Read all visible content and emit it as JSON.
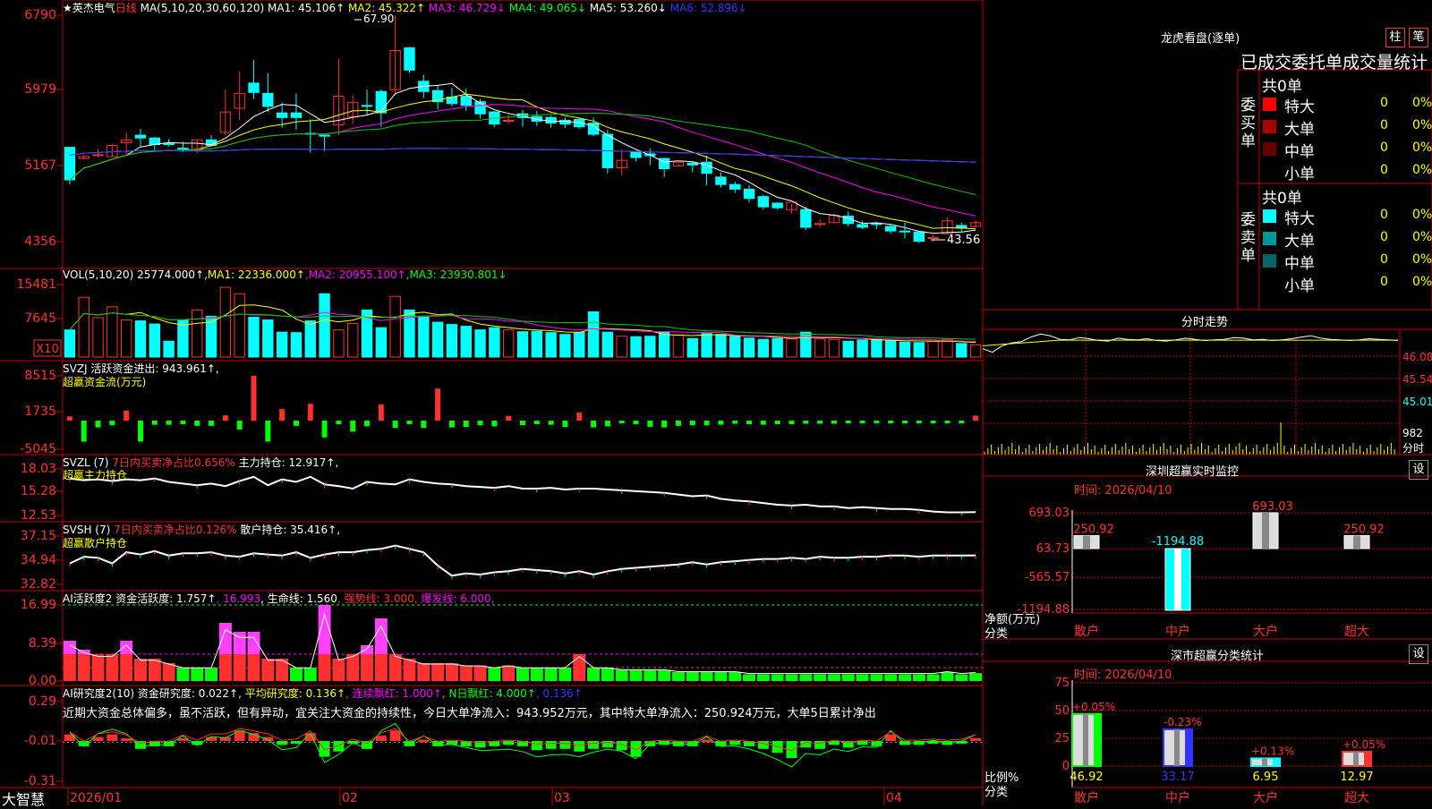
{
  "app": {
    "brand": "大智慧"
  },
  "stock": {
    "name": "英杰电气",
    "period": "日线"
  },
  "panels": {
    "price": {
      "header": [
        {
          "t": "★英杰电气",
          "c": "#ffffff"
        },
        {
          "t": "日线",
          "c": "#ff3030"
        },
        {
          "t": " MA(5,10,20,30,60,120) MA1: ",
          "c": "#ffffff"
        },
        {
          "t": "45.106↑",
          "c": "#ffffff"
        },
        {
          "t": " MA2: 45.322↑",
          "c": "#ffff00"
        },
        {
          "t": " MA3: 46.729↓",
          "c": "#ff00ff"
        },
        {
          "t": " MA4: 49.065↓",
          "c": "#00ff00"
        },
        {
          "t": " MA5: 53.260↓",
          "c": "#ffffff"
        },
        {
          "t": " MA6: 52.896↓",
          "c": "#3333ff"
        }
      ],
      "yticks": [
        "6790",
        "5979",
        "5167",
        "4356"
      ],
      "high_label": "67.90",
      "low_label": "43.56"
    },
    "vol": {
      "header": [
        {
          "t": "VOL(5,10,20) ",
          "c": "#ffffff"
        },
        {
          "t": "25774.000↑",
          "c": "#ffffff"
        },
        {
          "t": ",MA1: 22336.000↑",
          "c": "#ffff00"
        },
        {
          "t": ",MA2: 20955.100↑",
          "c": "#ff00ff"
        },
        {
          "t": ",MA3: 23930.801↓",
          "c": "#00ff00"
        }
      ],
      "yticks": [
        "15481",
        "7645"
      ],
      "unit_badge": "X10"
    },
    "svzj": {
      "header": [
        {
          "t": "SVZJ  活跃资金进出: 943.961↑,",
          "c": "#ffffff"
        }
      ],
      "sub": "超赢资金流(万元)",
      "yticks": [
        "8515",
        "1735",
        "-5045"
      ]
    },
    "svzl": {
      "header": [
        {
          "t": "SVZL (7) ",
          "c": "#ffffff"
        },
        {
          "t": "7日内买卖净占比0.656%",
          "c": "#ff3030"
        },
        {
          "t": " 主力持仓: 12.917↑,",
          "c": "#ffffff"
        }
      ],
      "sub": "超赢主力持仓",
      "yticks": [
        "18.03",
        "15.28",
        "12.53"
      ]
    },
    "svsh": {
      "header": [
        {
          "t": "SVSH (7) ",
          "c": "#ffffff"
        },
        {
          "t": "7日内买卖净占比0.126%",
          "c": "#ff3030"
        },
        {
          "t": " 散户持仓: 35.416↑,",
          "c": "#ffffff"
        }
      ],
      "sub": "超赢散户持仓",
      "yticks": [
        "37.15",
        "34.94",
        "32.82"
      ]
    },
    "ai1": {
      "header": [
        {
          "t": "AI活跃度2 资金活跃度: 1.757↑",
          "c": "#ffffff"
        },
        {
          "t": ", 16.993",
          "c": "#ff00ff"
        },
        {
          "t": ", 生命线: 1.560",
          "c": "#ffffff"
        },
        {
          "t": ", 强势线: 3.000",
          "c": "#ff3030"
        },
        {
          "t": ", 爆发线: 6.000,",
          "c": "#ff00ff"
        }
      ],
      "yticks": [
        "16.99",
        "8.39",
        "0.00"
      ]
    },
    "ai2": {
      "header": [
        {
          "t": "AI研究度2(10) 资金研究度: 0.022↑",
          "c": "#ffffff"
        },
        {
          "t": ", 平均研究度: 0.136↑",
          "c": "#ffff00"
        },
        {
          "t": ", 连续飘红: 1.000↑",
          "c": "#ff00ff"
        },
        {
          "t": ", N日飘红: 4.000↑",
          "c": "#00ff00"
        },
        {
          "t": ", 0.136↑",
          "c": "#3333ff"
        }
      ],
      "comment": "近期大资金总体偏多，虽不活跃，但有异动，宜关注大资金的持续性，今日大单净流入：943.952万元，其中特大单净流入：250.924万元，大单5日累计净出",
      "yticks": [
        "0.29",
        "-0.01",
        "-0.31"
      ]
    }
  },
  "xaxis": {
    "labels": [
      "2026/01",
      "02",
      "03",
      "04"
    ]
  },
  "right": {
    "lhkp": {
      "title": "龙虎看盘(逐单)",
      "tabs": [
        "柱",
        "笔"
      ],
      "subtitle": "已成交委托单成交量统计",
      "buy": {
        "label": "委买单",
        "total": "共0单",
        "rows": [
          {
            "name": "特大",
            "count": "0",
            "pct": "0%",
            "color": "#ff0000"
          },
          {
            "name": "大单",
            "count": "0",
            "pct": "0%",
            "color": "#aa0000"
          },
          {
            "name": "中单",
            "count": "0",
            "pct": "0%",
            "color": "#660000"
          },
          {
            "name": "小单",
            "count": "0",
            "pct": "0%",
            "color": ""
          }
        ]
      },
      "sell": {
        "label": "委卖单",
        "total": "共0单",
        "rows": [
          {
            "name": "特大",
            "count": "0",
            "pct": "0%",
            "color": "#00ffff"
          },
          {
            "name": "大单",
            "count": "0",
            "pct": "0%",
            "color": "#009999"
          },
          {
            "name": "中单",
            "count": "0",
            "pct": "0%",
            "color": "#006666"
          },
          {
            "name": "小单",
            "count": "0",
            "pct": "0%",
            "color": ""
          }
        ]
      }
    },
    "fszs": {
      "title": "分时走势",
      "yticks": [
        "46.08",
        "45.54",
        "45.01",
        "982",
        "分时"
      ]
    },
    "szcy": {
      "title": "深圳超赢实时监控",
      "set": "设",
      "time": "时间: 2026/04/10",
      "yticks": [
        "693.03",
        "63.73",
        "-565.57",
        "-1194.88"
      ],
      "ylabel1": "净额(万元)",
      "ylabel2": "分类"
    },
    "sscy": {
      "title": "深市超赢分类统计",
      "set": "设",
      "time": "时间: 2026/04/10",
      "yticks": [
        "75",
        "50",
        "25",
        "0"
      ],
      "ylabel1": "比例%",
      "ylabel2": "分类"
    }
  },
  "chart_data": [
    {
      "type": "candlestick",
      "title": "英杰电气 日线",
      "ylim": [
        43.56,
        67.9
      ],
      "ohlc": [
        [
          53.7,
          53.7,
          50.2,
          49.7
        ],
        [
          52.5,
          52.9,
          52.7,
          52.4
        ],
        [
          52.9,
          53.5,
          52.9,
          52.6
        ],
        [
          52.7,
          54.1,
          53.9,
          52.7
        ],
        [
          54.2,
          55.3,
          54.5,
          53.0
        ],
        [
          55.0,
          55.7,
          54.7,
          53.8
        ],
        [
          54.7,
          54.8,
          54.0,
          53.4
        ],
        [
          54.1,
          54.6,
          54.0,
          53.8
        ],
        [
          53.6,
          54.3,
          53.5,
          53.2
        ],
        [
          53.4,
          54.5,
          54.5,
          53.1
        ],
        [
          54.5,
          55.0,
          53.9,
          53.8
        ],
        [
          55.3,
          59.9,
          57.5,
          55.0
        ],
        [
          57.9,
          61.9,
          59.5,
          56.6
        ],
        [
          60.6,
          63.1,
          59.6,
          58.9
        ],
        [
          59.5,
          61.7,
          58.1,
          57.5
        ],
        [
          57.4,
          58.5,
          56.9,
          55.8
        ],
        [
          57.4,
          59.5,
          56.9,
          55.6
        ],
        [
          55.2,
          56.7,
          55.1,
          53.1
        ],
        [
          55.0,
          55.0,
          54.9,
          53.3
        ],
        [
          56.1,
          63.2,
          59.2,
          55.0
        ],
        [
          57.0,
          59.3,
          58.5,
          56.2
        ],
        [
          58.2,
          59.9,
          58.1,
          57.1
        ],
        [
          59.7,
          59.9,
          57.4,
          55.9
        ],
        [
          59.9,
          67.9,
          64.1,
          59.5
        ],
        [
          64.4,
          64.5,
          62.0,
          61.7
        ],
        [
          60.8,
          61.5,
          59.7,
          59.0
        ],
        [
          59.8,
          60.4,
          58.6,
          57.8
        ],
        [
          59.1,
          60.1,
          58.4,
          58.1
        ],
        [
          59.2,
          60.0,
          58.2,
          57.6
        ],
        [
          58.6,
          58.9,
          57.3,
          56.8
        ],
        [
          57.5,
          57.6,
          56.2,
          55.9
        ],
        [
          56.6,
          57.2,
          56.6,
          56.2
        ],
        [
          57.3,
          57.7,
          56.9,
          55.9
        ],
        [
          57.0,
          57.6,
          56.5,
          56.0
        ],
        [
          56.9,
          57.1,
          56.3,
          55.8
        ],
        [
          56.6,
          56.9,
          56.2,
          55.8
        ],
        [
          56.7,
          56.8,
          55.9,
          55.7
        ],
        [
          56.3,
          56.9,
          55.1,
          54.9
        ],
        [
          55.1,
          55.6,
          51.5,
          50.9
        ],
        [
          51.5,
          53.5,
          52.3,
          50.7
        ],
        [
          53.2,
          53.3,
          52.6,
          52.2
        ],
        [
          53.0,
          53.6,
          52.8,
          51.8
        ],
        [
          52.5,
          52.5,
          51.4,
          50.5
        ],
        [
          51.7,
          51.9,
          52.1,
          51.6
        ],
        [
          52.0,
          52.2,
          51.8,
          51.0
        ],
        [
          52.1,
          52.8,
          50.9,
          49.6
        ],
        [
          50.5,
          51.0,
          49.7,
          49.4
        ],
        [
          49.7,
          50.0,
          49.2,
          48.8
        ],
        [
          49.2,
          49.6,
          48.2,
          47.8
        ],
        [
          48.4,
          48.6,
          47.3,
          47.0
        ],
        [
          47.7,
          47.8,
          47.2,
          47.0
        ],
        [
          47.0,
          47.6,
          47.8,
          46.6
        ],
        [
          47.0,
          47.3,
          45.1,
          44.8
        ],
        [
          45.4,
          46.0,
          45.5,
          45.1
        ],
        [
          45.6,
          46.6,
          46.4,
          45.6
        ],
        [
          46.3,
          46.8,
          45.5,
          45.2
        ],
        [
          45.4,
          45.8,
          45.1,
          44.9
        ],
        [
          45.5,
          45.7,
          45.4,
          44.9
        ],
        [
          45.2,
          45.4,
          44.7,
          44.4
        ],
        [
          44.7,
          45.6,
          44.6,
          43.9
        ],
        [
          44.6,
          44.7,
          43.6,
          43.4
        ],
        [
          43.9,
          44.3,
          44.0,
          43.56
        ],
        [
          44.4,
          46.2,
          45.8,
          44.4
        ],
        [
          45.3,
          45.6,
          45.0,
          44.6
        ],
        [
          45.2,
          45.9,
          45.6,
          45.1
        ]
      ]
    },
    {
      "type": "bar",
      "title": "VOL(5,10,20)",
      "ylim": [
        0,
        17000
      ],
      "values": [
        6000,
        13200,
        8700,
        11100,
        8200,
        8000,
        7300,
        3500,
        8200,
        10400,
        9000,
        15400,
        14000,
        8800,
        8200,
        5500,
        5400,
        8000,
        14000,
        6000,
        7400,
        10400,
        6500,
        13400,
        10400,
        8800,
        7700,
        7200,
        6800,
        6000,
        6500,
        6000,
        5600,
        5700,
        5400,
        5000,
        5500,
        10000,
        5500,
        4600,
        4500,
        4600,
        5600,
        4900,
        4100,
        5200,
        5000,
        4600,
        4200,
        3900,
        4100,
        4000,
        5500,
        4000,
        3900,
        3500,
        3800,
        3900,
        3600,
        3300,
        3200,
        3500,
        3900,
        3000,
        2700
      ]
    },
    {
      "type": "bar",
      "title": "超赢资金流(万元)",
      "ylim": [
        -5045,
        8515
      ],
      "values": [
        800,
        -4000,
        -1300,
        -900,
        1900,
        -4000,
        -800,
        -800,
        -700,
        -1000,
        -1000,
        1000,
        -1700,
        8515,
        -4000,
        2200,
        -1000,
        3200,
        -3200,
        -700,
        -2100,
        -1100,
        3100,
        -1400,
        -700,
        -1400,
        6100,
        -1300,
        -1200,
        -900,
        -1100,
        900,
        -900,
        -700,
        -800,
        -1200,
        1500,
        -1300,
        -1100,
        -300,
        -700,
        -1200,
        -1300,
        -1000,
        -900,
        -900,
        -800,
        -600,
        -700,
        -800,
        -700,
        -700,
        -600,
        -600,
        -600,
        -500,
        -500,
        -500,
        -500,
        -500,
        -500,
        -500,
        -400,
        -300,
        943.961
      ]
    },
    {
      "type": "line",
      "title": "超赢主力持仓",
      "ylim": [
        12.53,
        18.03
      ],
      "values": [
        16.9,
        16.7,
        16.8,
        16.6,
        16.8,
        16.7,
        16.9,
        16.5,
        16.3,
        16.1,
        16.3,
        16.0,
        16.6,
        17.1,
        16.1,
        16.8,
        16.5,
        17.1,
        16.2,
        16.0,
        15.7,
        16.5,
        16.3,
        16.2,
        16.8,
        16.5,
        16.3,
        16.2,
        16.0,
        15.9,
        15.8,
        16.0,
        15.7,
        15.7,
        15.8,
        15.6,
        15.7,
        15.7,
        15.6,
        15.5,
        15.4,
        15.3,
        15.2,
        15.0,
        14.8,
        14.9,
        14.5,
        14.3,
        14.2,
        14.0,
        13.8,
        13.7,
        13.8,
        13.6,
        13.6,
        13.4,
        13.5,
        13.4,
        13.3,
        13.3,
        13.2,
        13.0,
        12.9,
        12.9,
        12.917
      ]
    },
    {
      "type": "line",
      "title": "超赢散户持仓",
      "ylim": [
        32.82,
        37.15
      ],
      "values": [
        34.7,
        35.3,
        35.2,
        34.7,
        35.7,
        35.5,
        35.8,
        35.4,
        35.6,
        35.6,
        35.7,
        35.4,
        35.3,
        35.6,
        35.5,
        35.4,
        35.7,
        35.2,
        35.5,
        35.7,
        35.7,
        35.9,
        36.0,
        36.3,
        36.0,
        35.7,
        34.5,
        33.6,
        33.8,
        33.7,
        33.9,
        34.0,
        34.2,
        34.1,
        34.0,
        33.8,
        34.0,
        33.7,
        34.0,
        34.2,
        34.3,
        34.4,
        34.5,
        34.6,
        34.8,
        34.6,
        34.8,
        34.9,
        35.0,
        35.1,
        35.1,
        35.2,
        35.1,
        35.3,
        35.2,
        35.2,
        35.3,
        35.3,
        35.4,
        35.4,
        35.3,
        35.4,
        35.4,
        35.4,
        35.416
      ]
    },
    {
      "type": "bar",
      "title": "AI活跃度2",
      "ylim": [
        0,
        16.99
      ],
      "values": [
        9.0,
        7.0,
        6.0,
        6.0,
        9.0,
        5.0,
        5.0,
        4.0,
        3.0,
        3.0,
        3.0,
        13.0,
        11.0,
        11.0,
        5.0,
        5.0,
        3.0,
        3.0,
        16.99,
        5.0,
        6.0,
        8.0,
        14.0,
        6.0,
        5.0,
        4.0,
        4.0,
        4.0,
        3.5,
        3.5,
        3.0,
        3.5,
        3.0,
        3.0,
        3.0,
        3.0,
        6.0,
        3.0,
        3.0,
        2.5,
        2.5,
        2.5,
        2.5,
        2.0,
        2.0,
        2.0,
        2.0,
        2.0,
        1.5,
        1.5,
        1.5,
        1.5,
        1.5,
        1.5,
        1.5,
        1.5,
        1.5,
        1.5,
        1.5,
        1.5,
        1.5,
        1.5,
        2.0,
        1.5,
        1.757
      ]
    },
    {
      "type": "bar",
      "title": "AI研究度2(10)",
      "ylim": [
        -0.31,
        0.29
      ],
      "values": [
        0.05,
        -0.04,
        0.03,
        0.05,
        0.02,
        -0.06,
        -0.04,
        -0.04,
        0.02,
        -0.03,
        0.03,
        0.03,
        0.08,
        0.06,
        0.03,
        -0.03,
        -0.02,
        0.06,
        -0.12,
        -0.08,
        -0.02,
        -0.06,
        0.04,
        0.08,
        -0.04,
        0.01,
        -0.04,
        -0.03,
        -0.04,
        -0.05,
        -0.04,
        -0.03,
        -0.04,
        -0.07,
        -0.06,
        -0.06,
        -0.08,
        -0.06,
        -0.05,
        -0.07,
        -0.12,
        -0.04,
        -0.03,
        -0.04,
        -0.04,
        0.01,
        -0.04,
        -0.03,
        -0.04,
        -0.06,
        -0.09,
        -0.13,
        -0.05,
        -0.06,
        -0.03,
        -0.05,
        -0.03,
        -0.04,
        0.05,
        -0.03,
        -0.03,
        -0.02,
        -0.03,
        -0.02,
        0.022
      ]
    },
    {
      "type": "bar",
      "title": "深圳超赢实时监控",
      "categories": [
        "散户",
        "中户",
        "大户",
        "超大"
      ],
      "values": [
        250.92,
        -1194.88,
        693.03,
        250.92
      ],
      "ylim": [
        -1194.88,
        693.03
      ]
    },
    {
      "type": "bar",
      "title": "深市超赢分类统计",
      "categories": [
        "散户",
        "中户",
        "大户",
        "超大"
      ],
      "values": [
        46.92,
        33.17,
        6.95,
        12.97
      ],
      "changes": [
        "+0.05%",
        "-0.23%",
        "+0.13%",
        "+0.05%"
      ],
      "ylim": [
        0,
        75
      ]
    },
    {
      "type": "line",
      "title": "分时走势",
      "ylim": [
        45.01,
        46.2
      ],
      "values": [
        45.9,
        45.84,
        45.95,
        46.0,
        46.02,
        46.1,
        46.15,
        46.12,
        46.06,
        46.05,
        46.09,
        46.07,
        46.04,
        46.03,
        46.08,
        46.06,
        46.05,
        46.07,
        46.04,
        46.03,
        46.05,
        46.08,
        46.06,
        46.04,
        46.05,
        46.06,
        46.09,
        46.08,
        46.05,
        46.06,
        46.04,
        46.05,
        46.07,
        46.1,
        46.12,
        46.08,
        46.06,
        46.05,
        46.04,
        46.05,
        46.07,
        46.06,
        46.05,
        46.04
      ]
    }
  ]
}
